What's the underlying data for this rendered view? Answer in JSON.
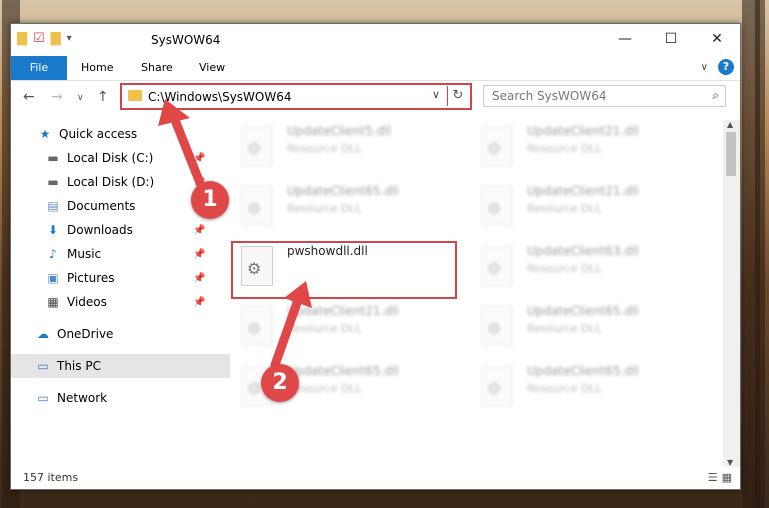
{
  "window": {
    "title": "SysWOW64"
  },
  "ribbon": {
    "tabs": [
      "File",
      "Home",
      "Share",
      "View"
    ],
    "help": "?"
  },
  "address": {
    "path": "C:\\Windows\\SysWOW64"
  },
  "search": {
    "placeholder": "Search SysWOW64"
  },
  "sidebar": {
    "items": [
      {
        "label": "Quick access",
        "icon": "star-icon"
      },
      {
        "label": "Local Disk (C:)",
        "icon": "drive-icon"
      },
      {
        "label": "Local Disk (D:)",
        "icon": "drive-icon"
      },
      {
        "label": "Documents",
        "icon": "documents-icon"
      },
      {
        "label": "Downloads",
        "icon": "download-icon"
      },
      {
        "label": "Music",
        "icon": "music-icon"
      },
      {
        "label": "Pictures",
        "icon": "pictures-icon"
      },
      {
        "label": "Videos",
        "icon": "videos-icon"
      },
      {
        "label": "OneDrive",
        "icon": "cloud-icon"
      },
      {
        "label": "This PC",
        "icon": "computer-icon"
      },
      {
        "label": "Network",
        "icon": "network-icon"
      }
    ]
  },
  "files": [
    {
      "name": "UpdateClient5.dll",
      "type": "Resource DLL"
    },
    {
      "name": "UpdateClient21.dll",
      "type": "Resource DLL"
    },
    {
      "name": "UpdateClient65.dll",
      "type": "Resource DLL"
    },
    {
      "name": "UpdateClient21.dll",
      "type": "Resource DLL"
    },
    {
      "name": "pwshowdll.dll",
      "type": ""
    },
    {
      "name": "UpdateClient63.dll",
      "type": "Resource DLL"
    },
    {
      "name": "UpdateClient21.dll",
      "type": "Resource DLL"
    },
    {
      "name": "UpdateClient65.dll",
      "type": "Resource DLL"
    },
    {
      "name": "UpdateClient65.dll",
      "type": "Resource DLL"
    },
    {
      "name": "UpdateClient65.dll",
      "type": "Resource DLL"
    }
  ],
  "status": {
    "items": "157 items"
  },
  "annotations": {
    "step1": "1",
    "step2": "2"
  },
  "colors": {
    "accent": "#1979ca",
    "highlight": "#d04545",
    "folder": "#f0c14a"
  }
}
